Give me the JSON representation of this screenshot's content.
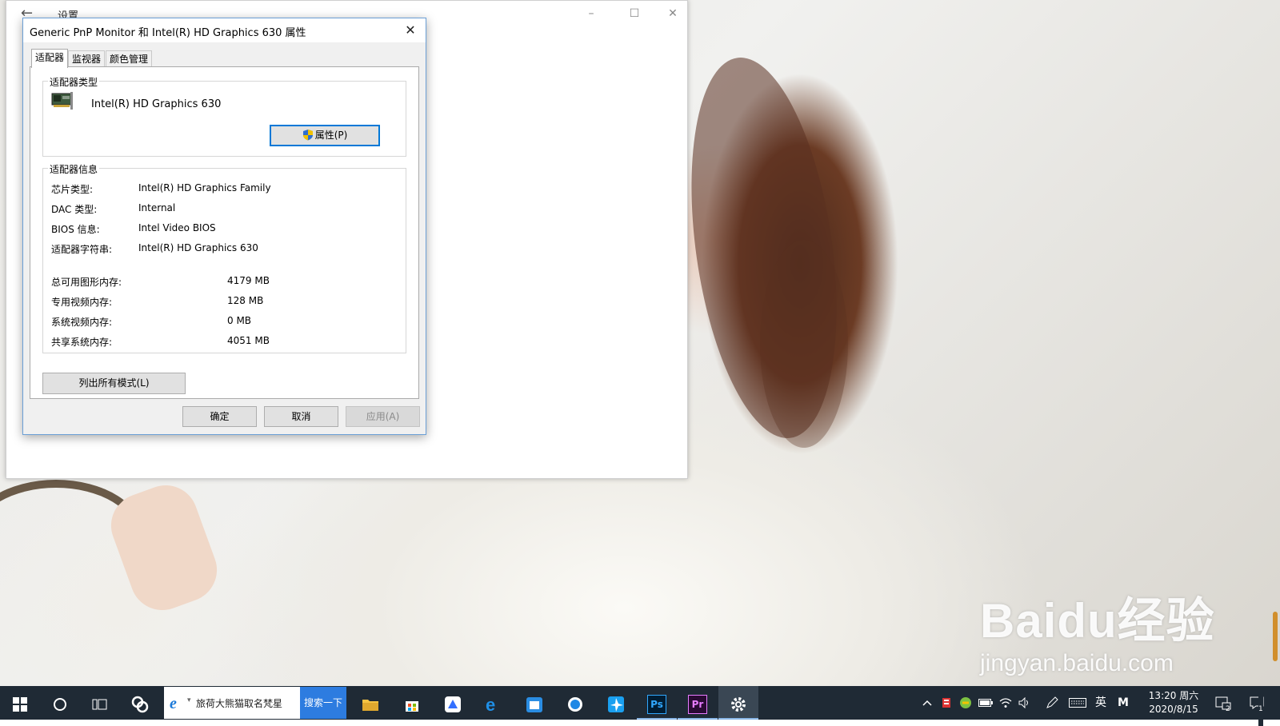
{
  "settings_window": {
    "title": "设置",
    "minimize_glyph": "–",
    "maximize_glyph": "☐",
    "close_glyph": "✕",
    "back_glyph": "←"
  },
  "dialog": {
    "title": "Generic PnP Monitor 和 Intel(R) HD Graphics 630 属性",
    "close_glyph": "✕",
    "tabs": [
      {
        "label": "适配器",
        "active": true
      },
      {
        "label": "监视器",
        "active": false
      },
      {
        "label": "颜色管理",
        "active": false
      }
    ],
    "adapter_type": {
      "group_label": "适配器类型",
      "adapter_name": "Intel(R) HD Graphics 630",
      "properties_button": "属性(P)"
    },
    "adapter_info": {
      "group_label": "适配器信息",
      "rows": [
        {
          "label": "芯片类型:",
          "value": "Intel(R) HD Graphics Family"
        },
        {
          "label": "DAC 类型:",
          "value": "Internal"
        },
        {
          "label": "BIOS 信息:",
          "value": "Intel Video BIOS"
        },
        {
          "label": "适配器字符串:",
          "value": "Intel(R) HD Graphics 630"
        }
      ],
      "memory_rows": [
        {
          "label": "总可用图形内存:",
          "value": "4179 MB"
        },
        {
          "label": "专用视频内存:",
          "value": "128 MB"
        },
        {
          "label": "系统视频内存:",
          "value": "0 MB"
        },
        {
          "label": "共享系统内存:",
          "value": "4051 MB"
        }
      ]
    },
    "list_modes_button": "列出所有模式(L)",
    "ok_button": "确定",
    "cancel_button": "取消",
    "apply_button": "应用(A)"
  },
  "taskbar": {
    "search_text": "旅荷大熊猫取名梵星",
    "search_button": "搜索一下",
    "ps_label": "Ps",
    "pr_label": "Pr",
    "ime_label": "英",
    "m_label": "M",
    "time": "13:20 周六",
    "date": "2020/8/15",
    "notification_count": "1",
    "tray_badge": "2"
  },
  "watermark": {
    "brand": "Baidu经验",
    "sub": "jingyan.baidu.com"
  },
  "colors": {
    "taskbar_bg": "#1f2a35",
    "accent": "#0078d7",
    "search_button_bg": "#2d7ce0",
    "dialog_border": "#6b9fd6"
  }
}
